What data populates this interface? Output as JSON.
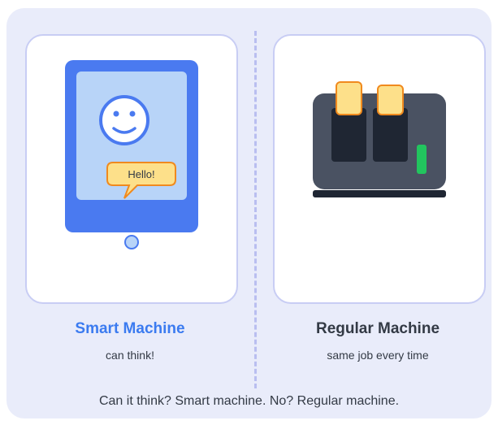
{
  "smart": {
    "title": "Smart Machine",
    "subtitle": "can think!",
    "speech": "Hello!"
  },
  "regular": {
    "title": "Regular Machine",
    "subtitle": "same job every time"
  },
  "summary": "Can it think? Smart machine. No? Regular machine.",
  "colors": {
    "panel_bg": "#e9ecfa",
    "card_border": "#c8cdf4",
    "tablet_blue": "#4a7af0",
    "screen_blue": "#b8d4f8",
    "toast": "#fde08a",
    "toast_border": "#f08a1e",
    "toaster_body": "#4a5262",
    "slot": "#1f2633",
    "indicator_green": "#22c55e",
    "smart_title": "#3b7bf0",
    "text_dark": "#333a45"
  }
}
